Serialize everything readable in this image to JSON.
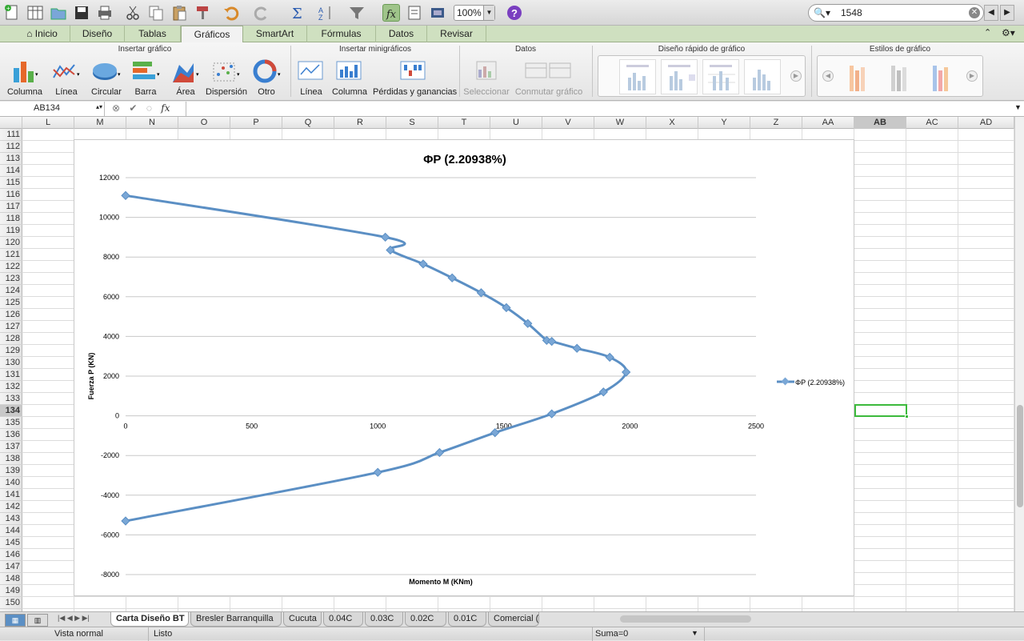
{
  "toolbar": {
    "zoom": "100%",
    "search_value": "1548",
    "icons": [
      "new-icon",
      "templates-icon",
      "open-icon",
      "save-icon",
      "print-icon",
      "cut-icon",
      "copy-icon",
      "paste-icon",
      "format-painter-icon",
      "undo-icon",
      "redo-icon",
      "autosum-icon",
      "sort-icon",
      "filter-icon",
      "formula-builder-icon",
      "toolbox-icon",
      "gallery-icon",
      "help-icon"
    ]
  },
  "ribbon_tabs": [
    "Inicio",
    "Diseño",
    "Tablas",
    "Gráficos",
    "SmartArt",
    "Fórmulas",
    "Datos",
    "Revisar"
  ],
  "active_tab": "Gráficos",
  "ribbon": {
    "groups": {
      "insert_chart": "Insertar gráfico",
      "sparklines": "Insertar minigráficos",
      "data": "Datos",
      "quick_layout": "Diseño rápido de gráfico",
      "chart_styles": "Estilos de gráfico"
    },
    "insert_chart_items": [
      "Columna",
      "Línea",
      "Circular",
      "Barra",
      "Área",
      "Dispersión",
      "Otro"
    ],
    "sparkline_items": [
      "Línea",
      "Columna",
      "Pérdidas y ganancias"
    ],
    "data_items": [
      "Seleccionar",
      "Conmutar gráfico"
    ]
  },
  "formula_bar": {
    "name_box": "AB134",
    "fx_label": "fx",
    "formula": ""
  },
  "columns": [
    "L",
    "M",
    "N",
    "O",
    "P",
    "Q",
    "R",
    "S",
    "T",
    "U",
    "V",
    "W",
    "X",
    "Y",
    "Z",
    "AA",
    "AB",
    "AC",
    "AD"
  ],
  "selected_column": "AB",
  "rows": [
    "111",
    "112",
    "113",
    "114",
    "115",
    "116",
    "117",
    "118",
    "119",
    "120",
    "121",
    "122",
    "123",
    "124",
    "125",
    "126",
    "127",
    "128",
    "129",
    "130",
    "131",
    "132",
    "133",
    "134",
    "135",
    "136",
    "137",
    "138",
    "139",
    "140",
    "141",
    "142",
    "143",
    "144",
    "145",
    "146",
    "147",
    "148",
    "149",
    "150"
  ],
  "selected_row": "134",
  "chart_data": {
    "type": "line",
    "title": "ΦP (2.20938%)",
    "xlabel": "Momento M (KNm)",
    "ylabel": "Fuerza P (KN)",
    "xlim": [
      0,
      2500
    ],
    "ylim": [
      -8000,
      12000
    ],
    "x_ticks": [
      "0",
      "500",
      "1000",
      "1500",
      "2000",
      "2500"
    ],
    "y_ticks": [
      "12000",
      "10000",
      "8000",
      "6000",
      "4000",
      "2000",
      "0",
      "-2000",
      "-4000",
      "-6000",
      "-8000"
    ],
    "grid": true,
    "legend_position": "right",
    "series": [
      {
        "name": "ΦP (2.20938%)",
        "color": "#5b8fc4",
        "x": [
          0,
          1030,
          1050,
          1180,
          1295,
          1410,
          1510,
          1595,
          1670,
          1690,
          1790,
          1920,
          1985,
          1895,
          1690,
          1465,
          1245,
          1000,
          0
        ],
        "y": [
          11100,
          9000,
          8350,
          7650,
          6950,
          6200,
          5450,
          4650,
          3800,
          3750,
          3400,
          2950,
          2200,
          1200,
          100,
          -850,
          -1850,
          -2850,
          -5300
        ]
      }
    ]
  },
  "sheet_tabs": [
    "Carta Diseño BT",
    "Bresler Barranquilla",
    "Cucuta",
    "0.04C",
    "0.03C",
    "0.02C",
    "0.01C",
    "Comercial ("
  ],
  "active_sheet": "Carta Diseño BT",
  "status": {
    "view": "Vista normal",
    "state": "Listo",
    "sum": "Suma=0"
  }
}
